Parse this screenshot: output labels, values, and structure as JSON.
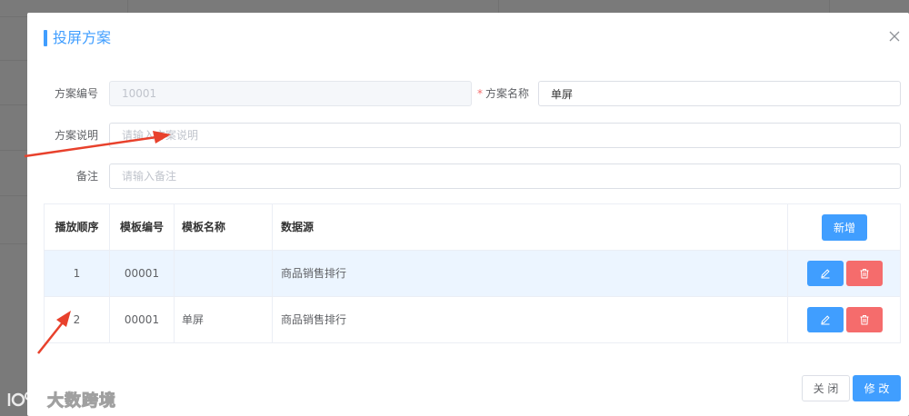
{
  "dialog": {
    "title": "投屏方案",
    "close_icon": "close-icon"
  },
  "form": {
    "scheme_no_label": "方案编号",
    "scheme_no_value": "10001",
    "scheme_name_label": "方案名称",
    "scheme_name_required": "*",
    "scheme_name_value": "单屏",
    "desc_label": "方案说明",
    "desc_placeholder": "请输入方案说明",
    "remark_label": "备注",
    "remark_placeholder": "请输入备注"
  },
  "table": {
    "headers": [
      "播放顺序",
      "模板编号",
      "模板名称",
      "数据源"
    ],
    "add_button": "新增",
    "rows": [
      {
        "order": "1",
        "template_no": "00001",
        "template_name": "",
        "data_source": "商品销售排行"
      },
      {
        "order": "2",
        "template_no": "00001",
        "template_name": "单屏",
        "data_source": "商品销售排行"
      }
    ],
    "edit_icon": "edit-icon",
    "delete_icon": "trash-icon"
  },
  "footer": {
    "close_button": "关 闭",
    "save_button": "修 改"
  },
  "watermark": {
    "text": "大数跨境"
  },
  "colors": {
    "primary": "#409eff",
    "danger": "#f56c6c",
    "row_highlight": "#ecf5ff",
    "annotation_arrow": "#e8412c"
  }
}
